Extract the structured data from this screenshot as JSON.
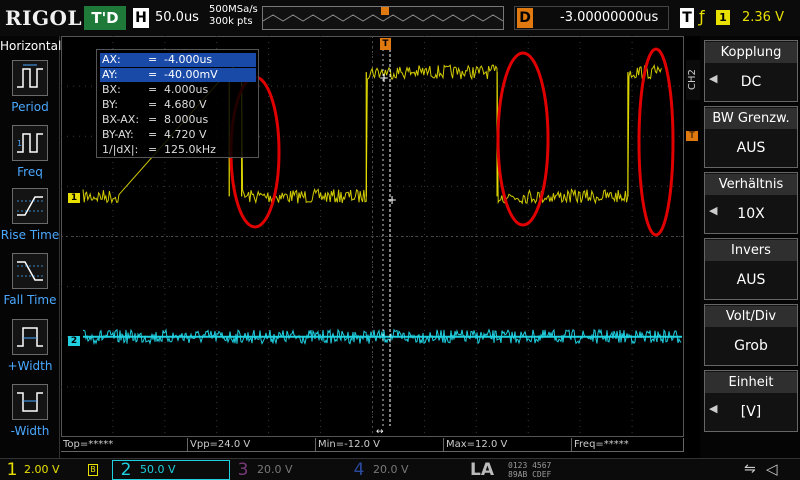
{
  "topbar": {
    "logo": "RIGOL",
    "run_status": "T'D",
    "h_letter": "H",
    "timebase": "50.0us",
    "sample_rate": "500MSa/s",
    "memory_depth": "300k pts",
    "trig_pos_glyph": "T",
    "d_letter": "D",
    "delay": "-3.00000000us",
    "t_letter": "T",
    "trigger_edge_glyph": "ƒ",
    "trigger_source": "1",
    "trigger_level": "2.36 V"
  },
  "left_panel": {
    "title": "Horizontal",
    "items": [
      {
        "label": "Period",
        "icon": "period-icon"
      },
      {
        "label": "Freq",
        "icon": "freq-icon"
      },
      {
        "label": "Rise Time",
        "icon": "rise-time-icon"
      },
      {
        "label": "Fall Time",
        "icon": "fall-time-icon"
      },
      {
        "label": "+Width",
        "icon": "pos-width-icon"
      },
      {
        "label": "-Width",
        "icon": "neg-width-icon"
      }
    ]
  },
  "cursor_readout": {
    "rows": [
      {
        "name": "AX:",
        "eq": "=",
        "value": "-4.000us",
        "selected": true
      },
      {
        "name": "AY:",
        "eq": "=",
        "value": "-40.00mV",
        "selected": true
      },
      {
        "name": "BX:",
        "eq": "=",
        "value": "4.000us",
        "selected": false
      },
      {
        "name": "BY:",
        "eq": "=",
        "value": "4.680 V",
        "selected": false
      },
      {
        "name": "BX-AX:",
        "eq": "=",
        "value": "8.000us",
        "selected": false
      },
      {
        "name": "BY-AY:",
        "eq": "=",
        "value": "4.720 V",
        "selected": false
      },
      {
        "name": "1/|dX|:",
        "eq": "=",
        "value": "125.0kHz",
        "selected": false
      }
    ]
  },
  "channel_markers": {
    "ch1": "1",
    "ch2": "2",
    "trigger": "T"
  },
  "measurements": [
    {
      "text": "Top=*****"
    },
    {
      "text": "Vpp=24.0 V"
    },
    {
      "text": "Min=-12.0 V"
    },
    {
      "text": "Max=12.0 V"
    },
    {
      "text": "Freq=*****"
    }
  ],
  "right_panel": {
    "channel_tab": "CH2",
    "items": [
      {
        "title": "Kopplung",
        "value": "DC",
        "has_arrow": true
      },
      {
        "title": "BW Grenzw.",
        "value": "AUS",
        "has_arrow": false
      },
      {
        "title": "Verhältnis",
        "value": "10X",
        "has_arrow": true
      },
      {
        "title": "Invers",
        "value": "AUS",
        "has_arrow": false
      },
      {
        "title": "Volt/Div",
        "value": "Grob",
        "has_arrow": false
      },
      {
        "title": "Einheit",
        "value": "[V]",
        "has_arrow": true
      }
    ]
  },
  "bottombar": {
    "ch1": {
      "num": "1",
      "scale": "2.00 V",
      "coupling_icon": "B"
    },
    "ch2": {
      "num": "2",
      "scale": "50.0 V"
    },
    "ch3": {
      "num": "3",
      "scale": "20.0 V"
    },
    "ch4": {
      "num": "4",
      "scale": "20.0 V"
    },
    "la": "LA",
    "la_channels_row1": "0123 4567",
    "la_channels_row2": "89AB CDEF",
    "usb_icon": "⇋",
    "speaker_icon": "◁"
  },
  "colors": {
    "ch1": "#e8e000",
    "ch2": "#20d0e0",
    "trigger": "#e07a10",
    "menu_accent": "#4aa8ff",
    "annotation": "#e00000"
  },
  "waveforms": {
    "ch1": {
      "shape": "square",
      "high_level_fraction": 0.09,
      "low_level_fraction": 0.4,
      "edges": [
        {
          "x_fraction": 0.27,
          "dir": "rise"
        },
        {
          "x_fraction": 0.29,
          "dir": "fall"
        },
        {
          "x_fraction": 0.49,
          "dir": "rise"
        },
        {
          "x_fraction": 0.7,
          "dir": "fall"
        },
        {
          "x_fraction": 0.91,
          "dir": "rise"
        }
      ]
    },
    "ch2": {
      "shape": "noise",
      "level_fraction": 0.75
    }
  }
}
